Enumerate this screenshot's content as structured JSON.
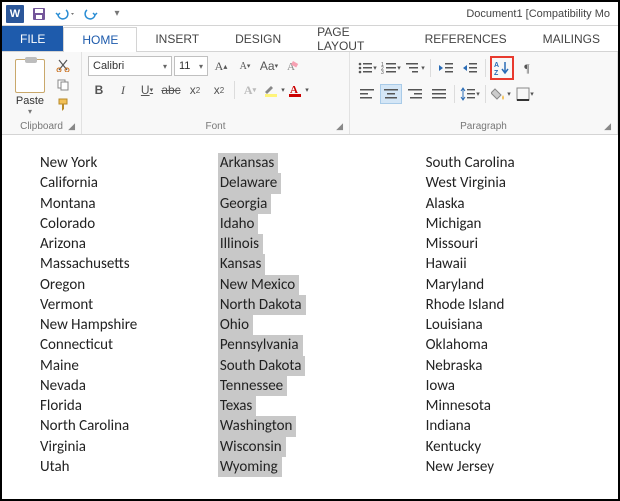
{
  "title": "Document1 [Compatibility Mo",
  "qat": {
    "save": "💾",
    "undo": "↶",
    "redo": "↻"
  },
  "tabs": {
    "file": "FILE",
    "home": "HOME",
    "insert": "INSERT",
    "design": "DESIGN",
    "layout": "PAGE LAYOUT",
    "references": "REFERENCES",
    "mailings": "MAILINGS"
  },
  "ribbon": {
    "clipboard": {
      "paste": "Paste",
      "label": "Clipboard"
    },
    "font": {
      "name": "Calibri",
      "size": "11",
      "label": "Font",
      "bold": "B",
      "italic": "I",
      "underline": "U"
    },
    "paragraph": {
      "label": "Paragraph",
      "sort_tip": "A→Z Sort"
    }
  },
  "columns": {
    "col1": [
      "New York",
      "California",
      "Montana",
      "Colorado",
      "Arizona",
      "Massachusetts",
      "Oregon",
      "Vermont",
      "New Hampshire",
      "Connecticut",
      "Maine",
      "Nevada",
      "Florida",
      "North Carolina",
      "Virginia",
      "Utah"
    ],
    "col2": [
      "Arkansas",
      "Delaware",
      "Georgia",
      "Idaho",
      "Illinois",
      "Kansas",
      "New Mexico",
      "North Dakota",
      "Ohio",
      "Pennsylvania",
      "South Dakota",
      "Tennessee",
      "Texas",
      "Washington",
      "Wisconsin",
      "Wyoming"
    ],
    "col3": [
      "South Carolina",
      "West Virginia",
      "Alaska",
      "Michigan",
      "Missouri",
      "Hawaii",
      "Maryland",
      "Rhode Island",
      "Louisiana",
      "Oklahoma",
      "Nebraska",
      "Iowa",
      "Minnesota",
      "Indiana",
      "Kentucky",
      "New Jersey"
    ]
  }
}
